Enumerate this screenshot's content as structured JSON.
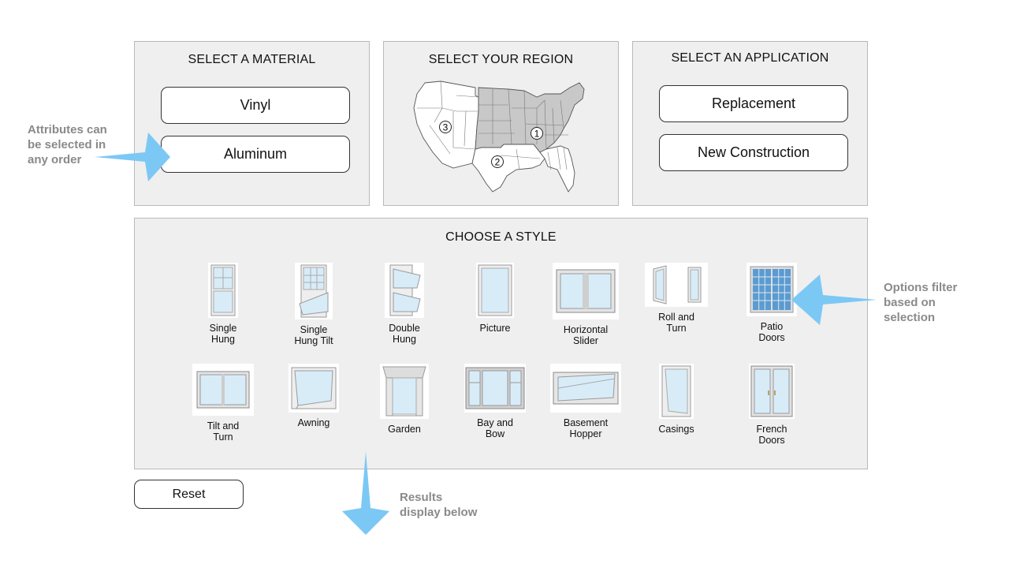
{
  "material": {
    "title": "SELECT A MATERIAL",
    "options": [
      "Vinyl",
      "Aluminum"
    ]
  },
  "region": {
    "title": "SELECT YOUR REGION",
    "markers": [
      "1",
      "2",
      "3"
    ]
  },
  "application": {
    "title": "SELECT AN APPLICATION",
    "options": [
      "Replacement",
      "New Construction"
    ]
  },
  "styles": {
    "title": "CHOOSE A STYLE",
    "row1": [
      {
        "label": "Single\nHung",
        "icon": "single-hung-window-icon"
      },
      {
        "label": "Single\nHung Tilt",
        "icon": "single-hung-tilt-window-icon"
      },
      {
        "label": "Double\nHung",
        "icon": "double-hung-window-icon"
      },
      {
        "label": "Picture",
        "icon": "picture-window-icon"
      },
      {
        "label": "Horizontal\nSlider",
        "icon": "horizontal-slider-window-icon"
      },
      {
        "label": "Roll and\nTurn",
        "icon": "roll-and-turn-window-icon"
      },
      {
        "label": "Patio\nDoors",
        "icon": "patio-doors-icon"
      }
    ],
    "row2": [
      {
        "label": "Tilt and\nTurn",
        "icon": "tilt-and-turn-window-icon"
      },
      {
        "label": "Awning",
        "icon": "awning-window-icon"
      },
      {
        "label": "Garden",
        "icon": "garden-window-icon"
      },
      {
        "label": "Bay and\nBow",
        "icon": "bay-and-bow-window-icon"
      },
      {
        "label": "Basement\nHopper",
        "icon": "basement-hopper-window-icon"
      },
      {
        "label": "Casings",
        "icon": "casings-window-icon"
      },
      {
        "label": "French\nDoors",
        "icon": "french-doors-icon"
      }
    ]
  },
  "reset_label": "Reset",
  "notes": {
    "attributes": "Attributes can\nbe selected in\nany order",
    "options": "Options filter\nbased on\nselection",
    "results": "Results\ndisplay below"
  },
  "colors": {
    "annotation_arrow": "#7cc8f5",
    "panel_bg": "#efefef",
    "map_highlight": "#c8c8c8",
    "patio_glass": "#5b9bd0"
  }
}
